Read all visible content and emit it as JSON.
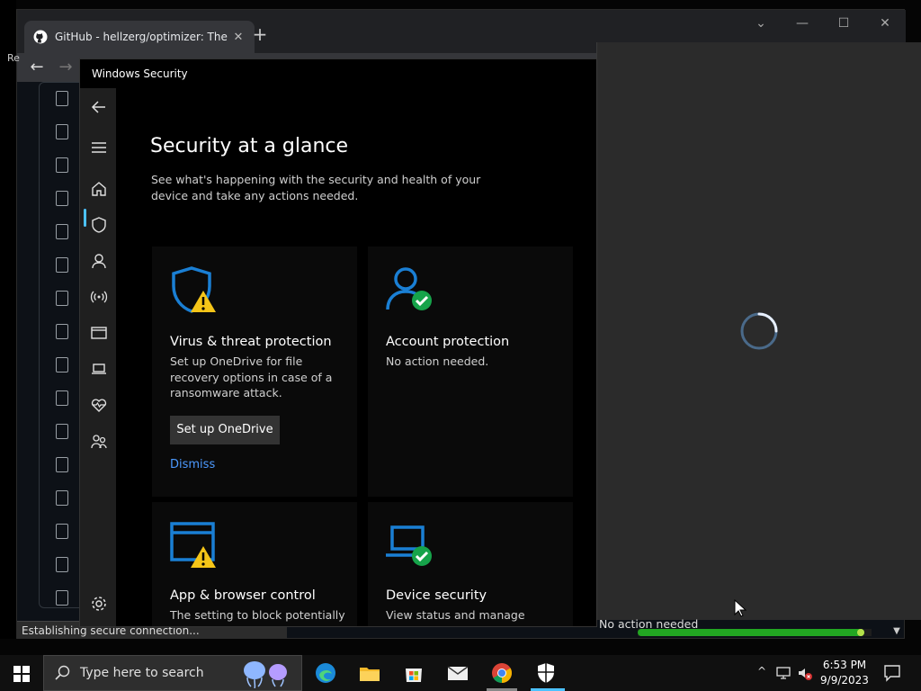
{
  "browser": {
    "tab_title": "GitHub - hellzerg/optimizer: The",
    "tab_close": "✕",
    "new_tab": "+",
    "status_text": "Establishing secure connection...",
    "controls": {
      "dropdown": "⌄",
      "minimize": "—",
      "maximize": "☐",
      "close": "✕"
    },
    "nav": {
      "back": "←",
      "forward": "→"
    },
    "edge_text": "Re",
    "progress": 0.97
  },
  "security": {
    "window_title": "Windows Security",
    "page_title": "Security at a glance",
    "page_subtitle": "See what's happening with the security and health of your device and take any actions needed.",
    "cards": [
      {
        "title": "Virus & threat protection",
        "desc": "Set up OneDrive for file recovery options in case of a ransomware attack.",
        "button": "Set up OneDrive",
        "link": "Dismiss"
      },
      {
        "title": "Account protection",
        "desc": "No action needed."
      },
      {
        "title": "App & browser control",
        "desc": "The setting to block potentially unwanted apps is turned off."
      },
      {
        "title": "Device security",
        "desc": "View status and manage hardware security features"
      }
    ],
    "peek_text": "No action needed"
  },
  "taskbar": {
    "search_placeholder": "Type here to search",
    "time": "6:53 PM",
    "date": "9/9/2023"
  },
  "colors": {
    "accent": "#4cc2ff",
    "shield_blue": "#1a7fd4",
    "warning_yellow": "#f5c518",
    "ok_green": "#16a34a",
    "link_blue": "#4c9aff"
  }
}
